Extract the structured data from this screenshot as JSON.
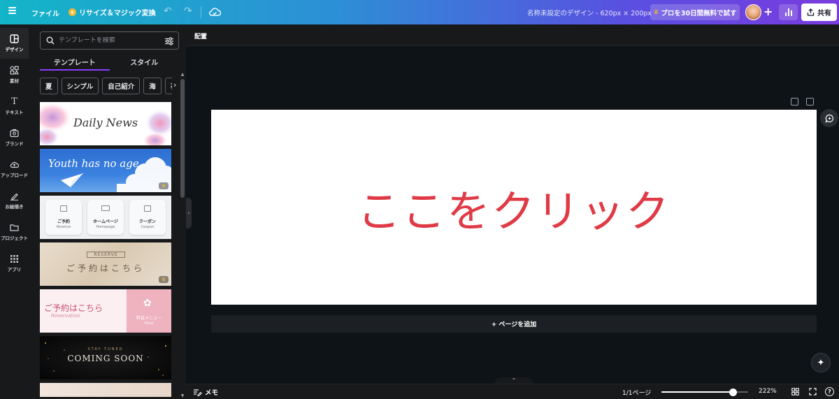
{
  "topbar": {
    "menu_icon": "hamburger-icon",
    "file_label": "ファイル",
    "resize_label": "リサイズ＆マジック変換",
    "resize_icon": "crown-icon",
    "undo_icon": "undo-icon",
    "redo_icon": "redo-icon",
    "save_icon": "cloud-icon",
    "design_title": "名称未設定のデザイン - 620px × 200px",
    "pro_trial_label": "プロを30日間無料で試す",
    "share_label": "共有",
    "share_icon": "upload-icon",
    "analytics_icon": "bar-chart-icon",
    "add_collaborator_icon": "plus-icon"
  },
  "rail": {
    "items": [
      {
        "label": "デザイン",
        "icon": "layout-icon",
        "active": true
      },
      {
        "label": "素材",
        "icon": "shapes-icon",
        "active": false
      },
      {
        "label": "テキスト",
        "icon": "text-icon",
        "active": false
      },
      {
        "label": "ブランド",
        "icon": "brand-icon",
        "active": false
      },
      {
        "label": "アップロード",
        "icon": "cloud-upload-icon",
        "active": false
      },
      {
        "label": "お絵描き",
        "icon": "pen-icon",
        "active": false
      },
      {
        "label": "プロジェクト",
        "icon": "folder-icon",
        "active": false
      },
      {
        "label": "アプリ",
        "icon": "apps-grid-icon",
        "active": false
      }
    ]
  },
  "panel": {
    "search_placeholder": "テンプレートを検索",
    "tabs": [
      {
        "label": "テンプレート",
        "active": true
      },
      {
        "label": "スタイル",
        "active": false
      }
    ],
    "chips": [
      "夏",
      "シンプル",
      "自己紹介",
      "海",
      "花"
    ],
    "templates": [
      {
        "text": "Daily News",
        "style": "watercolor-white"
      },
      {
        "text": "Youth has no age",
        "style": "blue-sky"
      },
      {
        "text": "ご予約 / ホームページ / クーポン",
        "labels": [
          "ご予約",
          "ホームページ",
          "クーポン"
        ],
        "sub": [
          "Reserve",
          "Homepage",
          "Coupon"
        ],
        "style": "gray-buttons"
      },
      {
        "text": "ご予約はこちら",
        "badge": "RESERVE",
        "style": "beige-marble"
      },
      {
        "text": "ご予約はこちら",
        "sub": "Reservation",
        "side": "料金メニュー",
        "side_sub": "Price",
        "style": "pink-split"
      },
      {
        "text": "COMING SOON",
        "top": "STAY TUNED",
        "style": "black-gold"
      }
    ]
  },
  "editor": {
    "arrange_label": "配置",
    "canvas_text": "ここをクリック",
    "add_page_label": "+ ページを追加"
  },
  "bottombar": {
    "memo_label": "メモ",
    "page_count": "1/1ページ",
    "zoom_value": "222%",
    "zoom_fraction": 0.82,
    "help_label": "?"
  },
  "colors": {
    "accent": "#8b3dff",
    "canvas_text": "#e03a46",
    "panel_bg": "#18191b",
    "workspace_bg": "#0e1318"
  }
}
